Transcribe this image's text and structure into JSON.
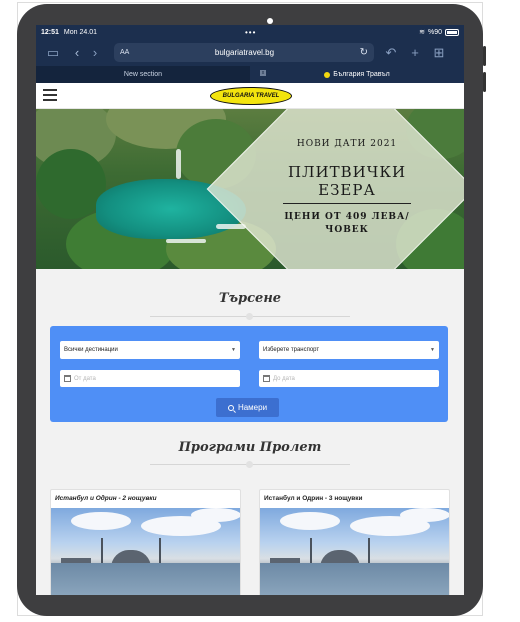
{
  "status_bar": {
    "time": "12:51",
    "date": "Mon 24.01",
    "battery": "%90",
    "dots": "•••"
  },
  "browser": {
    "address_label": "AA",
    "url": "bulgariatravel.bg",
    "tabs": [
      {
        "label": "New section",
        "active": false
      },
      {
        "label": "България Травъл",
        "active": true
      }
    ],
    "tab_close": "x"
  },
  "site": {
    "logo_text": "BULGARIA TRAVEL",
    "hero": {
      "subtitle": "НОВИ ДАТИ 2021",
      "title_line1": "ПЛИТВИЧКИ",
      "title_line2": "ЕЗЕРА",
      "price_line1": "ЦЕНИ ОТ 409 ЛЕВА/",
      "price_line2": "ЧОВЕК"
    },
    "search": {
      "heading": "Търсене",
      "destination": "Всички дестинации",
      "transport": "Изберете транспорт",
      "from_date_placeholder": "От дата",
      "to_date_placeholder": "До дата",
      "button": "Намери"
    },
    "programs": {
      "heading": "Програми Пролет",
      "cards": [
        {
          "title": "Истанбул и Одрин - 2 нощувки"
        },
        {
          "title": "Истанбул и Одрин - 3 нощувки"
        }
      ]
    }
  },
  "colors": {
    "browser_chrome": "#1c2f4e",
    "search_panel": "#4f8ff6",
    "logo_yellow": "#f3e40e"
  }
}
